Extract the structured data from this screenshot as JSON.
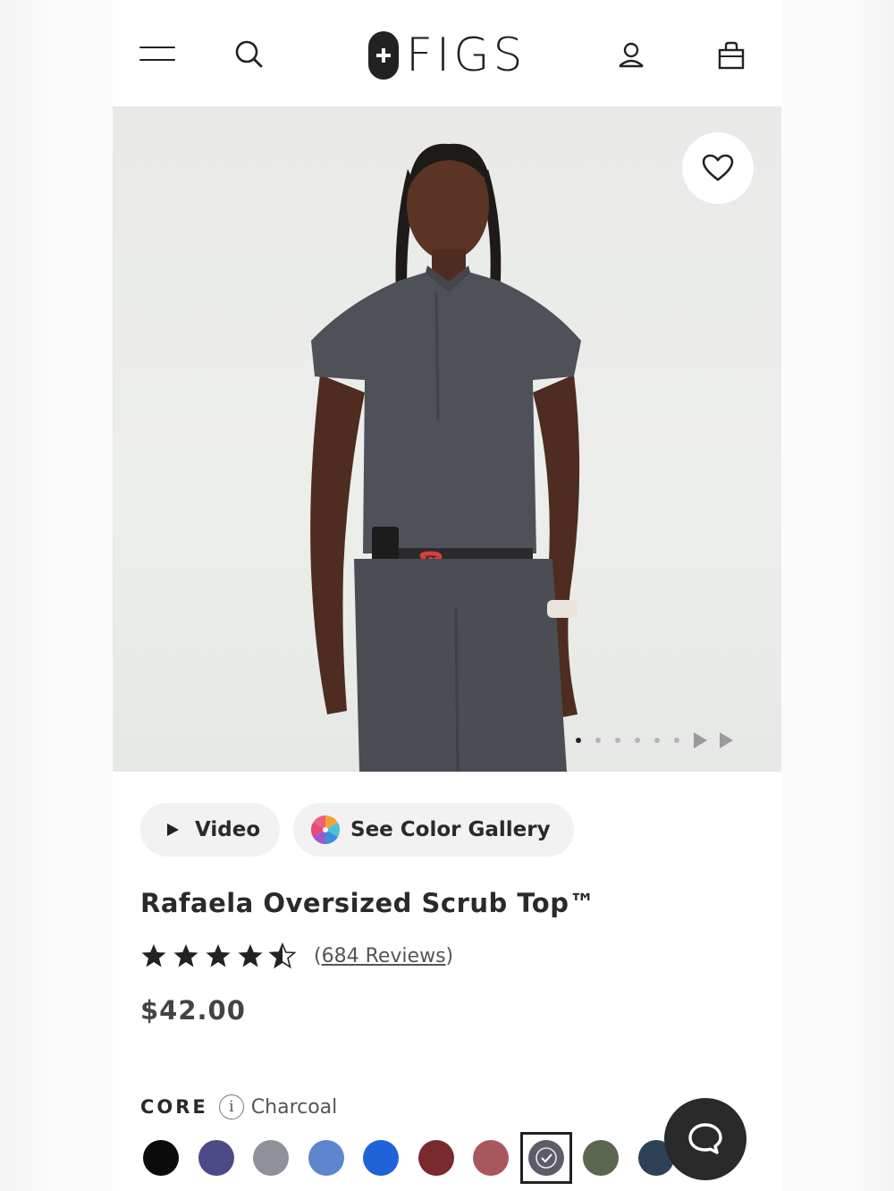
{
  "header": {
    "logo_text": "FIGS",
    "icons": [
      "menu-icon",
      "search-icon",
      "account-icon",
      "bag-icon"
    ]
  },
  "hero": {
    "image_description_icon": "product-photo",
    "favorite_icon": "heart-icon",
    "slides_total": 6,
    "slide_active": 1
  },
  "actions": {
    "video_label": "Video",
    "gallery_label": "See Color Gallery"
  },
  "product": {
    "title": "Rafaela Oversized Scrub Top™",
    "rating": 4.5,
    "reviews_label": "684 Reviews",
    "price": "$42.00"
  },
  "colors": {
    "group_label": "CORE",
    "selected_name": "Charcoal",
    "swatches": [
      "#0b0b0b",
      "#4b4a86",
      "#8e9199",
      "#5e86cf",
      "#1f63d9",
      "#7a2a2c",
      "#a8585d",
      "#5f5b69",
      "#5b6651",
      "#2e4257"
    ],
    "selected_index": 7
  },
  "chat": {
    "icon": "chat-icon"
  }
}
